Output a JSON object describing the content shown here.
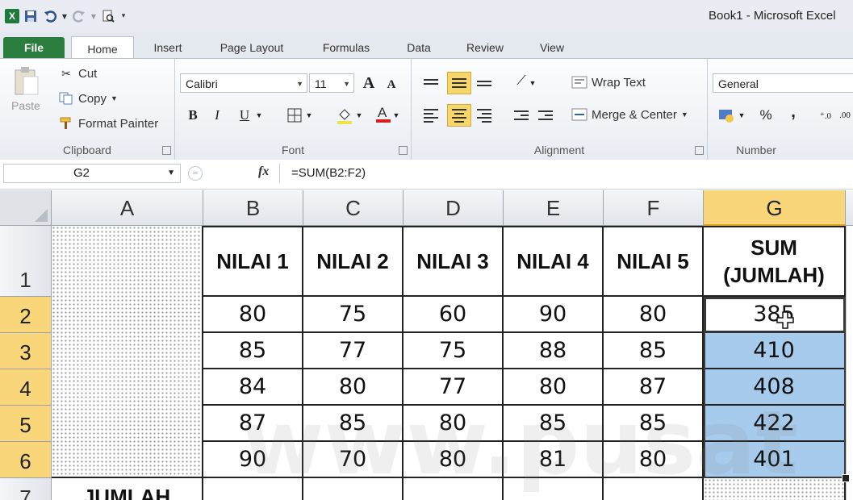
{
  "titlebar": {
    "title": "Book1 - Microsoft Excel",
    "qat_icons": [
      "excel-logo",
      "save-icon",
      "undo-icon",
      "redo-icon",
      "print-preview-icon",
      "customize-icon"
    ]
  },
  "tabs": [
    {
      "label": "File"
    },
    {
      "label": "Home"
    },
    {
      "label": "Insert"
    },
    {
      "label": "Page Layout"
    },
    {
      "label": "Formulas"
    },
    {
      "label": "Data"
    },
    {
      "label": "Review"
    },
    {
      "label": "View"
    }
  ],
  "ribbon": {
    "clipboard": {
      "paste": "Paste",
      "cut": "Cut",
      "copy": "Copy",
      "format_painter": "Format Painter",
      "label": "Clipboard"
    },
    "font": {
      "name": "Calibri",
      "size": "11",
      "bold": "B",
      "italic": "I",
      "underline": "U",
      "label": "Font"
    },
    "alignment": {
      "wrap_text": "Wrap Text",
      "merge_center": "Merge & Center",
      "label": "Alignment"
    },
    "number": {
      "format": "General",
      "percent": "%",
      "comma": ",",
      "label": "Number"
    }
  },
  "formula_bar": {
    "name_box": "G2",
    "fx": "fx",
    "formula": "=SUM(B2:F2)"
  },
  "sheet": {
    "columns": [
      "A",
      "B",
      "C",
      "D",
      "E",
      "F",
      "G"
    ],
    "rows": [
      "1",
      "2",
      "3",
      "4",
      "5",
      "6",
      "7"
    ],
    "headers": [
      "NILAI 1",
      "NILAI 2",
      "NILAI 3",
      "NILAI 4",
      "NILAI 5"
    ],
    "sum_header": [
      "SUM",
      "(JUMLAH)"
    ],
    "data": [
      [
        "80",
        "75",
        "60",
        "90",
        "80",
        "385"
      ],
      [
        "85",
        "77",
        "75",
        "88",
        "85",
        "410"
      ],
      [
        "84",
        "80",
        "77",
        "80",
        "87",
        "408"
      ],
      [
        "87",
        "85",
        "80",
        "85",
        "85",
        "422"
      ],
      [
        "90",
        "70",
        "80",
        "81",
        "80",
        "401"
      ]
    ],
    "row7_label": "JUMLAH",
    "active_cell": "G2",
    "selection_color": "#a7cbed",
    "header_highlight": "#f9d67a"
  },
  "watermark": "www.pusat"
}
